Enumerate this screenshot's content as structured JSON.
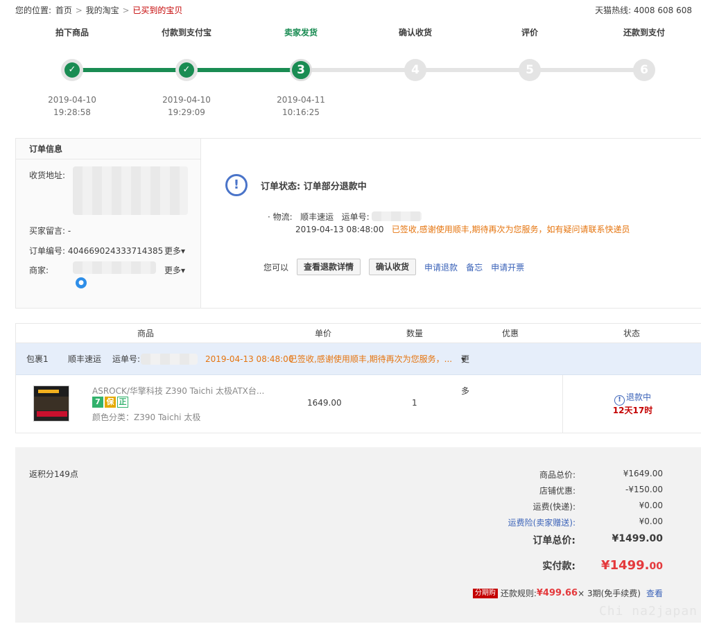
{
  "topbar": {
    "position_label": "您的位置:",
    "crumbs": [
      "首页",
      "我的淘宝",
      "已买到的宝贝"
    ],
    "separator": ">",
    "hotline": "天猫热线: 4008 608 608"
  },
  "steps": [
    {
      "label": "拍下商品",
      "date": "2019-04-10",
      "time": "19:28:58",
      "state": "done"
    },
    {
      "label": "付款到支付宝",
      "date": "2019-04-10",
      "time": "19:29:09",
      "state": "done"
    },
    {
      "label": "卖家发货",
      "date": "2019-04-11",
      "time": "10:16:25",
      "state": "current",
      "number": "3"
    },
    {
      "label": "确认收货",
      "number": "4",
      "state": "todo"
    },
    {
      "label": "评价",
      "number": "5",
      "state": "todo"
    },
    {
      "label": "还款到支付",
      "number": "6",
      "state": "todo"
    }
  ],
  "order_info": {
    "title": "订单信息",
    "address_label": "收货地址:",
    "message_label": "买家留言:",
    "message_value": "-",
    "order_no_label": "订单编号:",
    "order_no": "404669024333714385",
    "merchant_label": "商家:",
    "more": "更多"
  },
  "status": {
    "icon": "!",
    "title": "订单状态: 订单部分退款中",
    "logistics_label": "· 物流:",
    "carrier": "顺丰速运",
    "waybill_label": "运单号:",
    "log_time": "2019-04-13 08:48:00",
    "log_text": "已签收,感谢使用顺丰,期待再次为您服务，如有疑问请联系快递员",
    "actions_label": "您可以",
    "btn_refund_detail": "查看退款详情",
    "btn_confirm": "确认收货",
    "link_refund": "申请退款",
    "link_memo": "备忘",
    "link_invoice": "申请开票"
  },
  "table": {
    "headers": {
      "product": "商品",
      "price": "单价",
      "qty": "数量",
      "discount": "优惠",
      "state": "状态"
    },
    "package": {
      "name": "包裹1",
      "carrier": "顺丰速运",
      "waybill_label": "运单号:",
      "time": "2019-04-13 08:48:00",
      "text": "已签收,感谢使用顺丰,期待再次为您服务，...",
      "more": "更多"
    },
    "item": {
      "title": "ASROCK/华擎科技 Z390 Taichi 太极ATX台...",
      "badges": [
        "7",
        "保",
        "正"
      ],
      "sku": "颜色分类：Z390 Taichi 太极",
      "price": "1649.00",
      "qty": "1",
      "state_icon": "!",
      "state": "退款中",
      "remaining": "12天17时"
    }
  },
  "totals": {
    "points": "返积分149点",
    "goods_label": "商品总价:",
    "goods": "¥1649.00",
    "shop_discount_label": "店铺优惠:",
    "shop_discount": "-¥150.00",
    "shipping_label": "运费(快递):",
    "shipping": "¥0.00",
    "insurance_label": "运费险(卖家赠送):",
    "insurance": "¥0.00",
    "order_total_label": "订单总价:",
    "order_total": "¥1499.00",
    "paid_label": "实付款:",
    "paid_main": "¥1499.",
    "paid_cents": "00",
    "installment_tag": "分期购",
    "installment_label": "还款规则:",
    "installment_amount": "¥499.66",
    "installment_rest": "× 3期(免手续费)",
    "installment_link": "查看"
  },
  "watermark": "Chi na2japan"
}
